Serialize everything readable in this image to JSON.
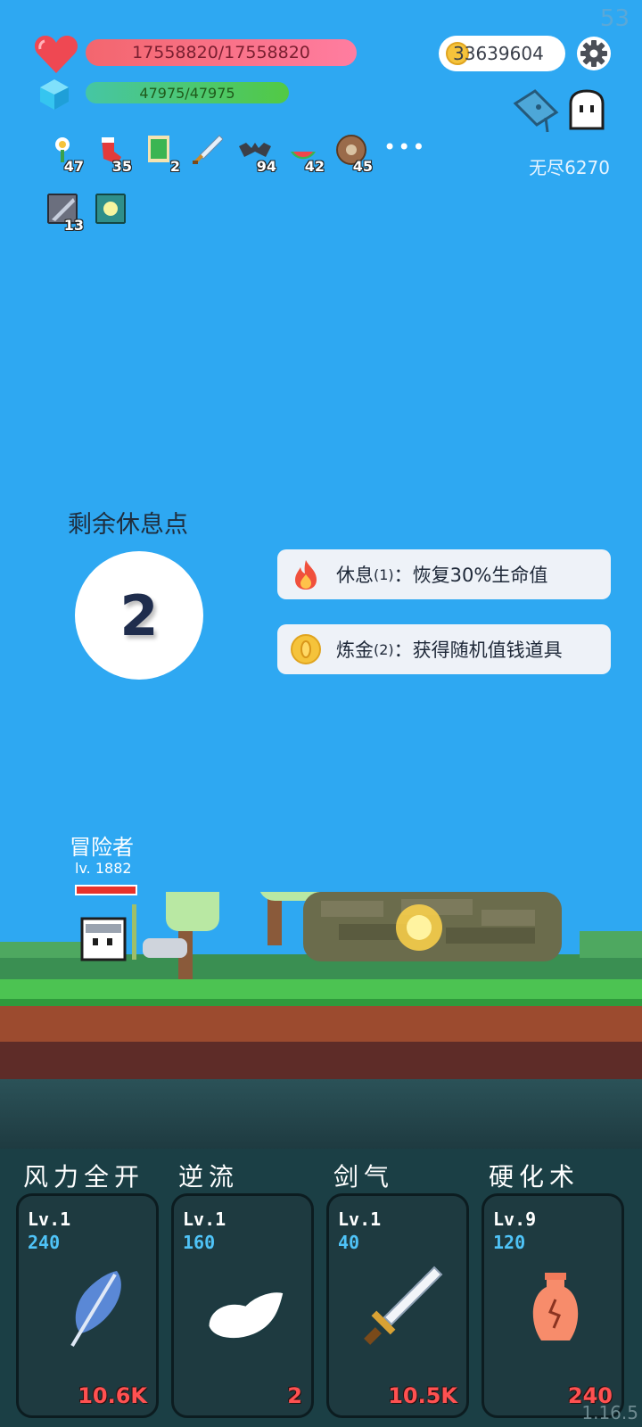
{
  "hud": {
    "fps": "53",
    "hp_text": "17558820/17558820",
    "mp_text": "47975/47975",
    "gold_text": "33639604",
    "endless_label": "无尽6270"
  },
  "items": [
    {
      "icon": "flower-icon",
      "count": "47"
    },
    {
      "icon": "sock-icon",
      "count": "35"
    },
    {
      "icon": "card-icon",
      "count": "2"
    },
    {
      "icon": "sword-icon",
      "count": ""
    },
    {
      "icon": "bat-icon",
      "count": "94"
    },
    {
      "icon": "watermelon-icon",
      "count": "42"
    },
    {
      "icon": "shield-icon",
      "count": "45"
    }
  ],
  "more_label": "•••",
  "items_row2": [
    {
      "icon": "blade-icon",
      "count": "13"
    },
    {
      "icon": "light-icon",
      "count": ""
    }
  ],
  "rest": {
    "title": "剩余休息点",
    "points": "2"
  },
  "options": [
    {
      "name": "休息",
      "count": "(1)",
      "desc": "：恢复30%生命值"
    },
    {
      "name": "炼金",
      "count": "(2)",
      "desc": "：获得随机值钱道具"
    }
  ],
  "player": {
    "name": "冒险者",
    "level": "lv. 1882",
    "hp_fraction": 1.0
  },
  "skills": [
    {
      "name": "风力全开",
      "lv": "Lv.1",
      "cost": "240",
      "value": "10.6K",
      "icon": "feather-icon"
    },
    {
      "name": "逆流",
      "lv": "Lv.1",
      "cost": "160",
      "value": "2",
      "icon": "wing-icon"
    },
    {
      "name": "剑气",
      "lv": "Lv.1",
      "cost": "40",
      "value": "10.5K",
      "icon": "sword-icon"
    },
    {
      "name": "硬化术",
      "lv": "Lv.9",
      "cost": "120",
      "value": "240",
      "icon": "vase-icon"
    }
  ],
  "version": "1.16.5",
  "colors": {
    "sky": "#2ea8f2",
    "hp_bar": "#f3666e",
    "mp_bar": "#52c944",
    "skill_cost": "#4fc3f7",
    "skill_value": "#ff5151"
  }
}
